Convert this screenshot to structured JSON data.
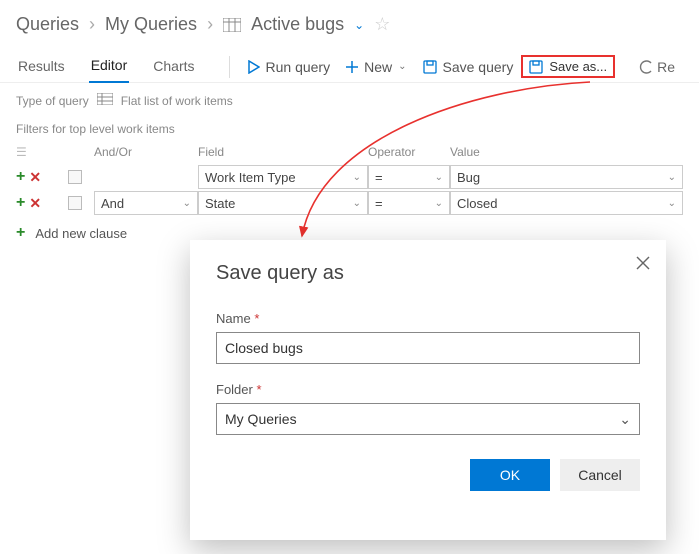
{
  "breadcrumb": {
    "root": "Queries",
    "mid": "My Queries",
    "leaf": "Active bugs"
  },
  "tabs": {
    "results": "Results",
    "editor": "Editor",
    "charts": "Charts"
  },
  "toolbar": {
    "run": "Run query",
    "new": "New",
    "save": "Save query",
    "saveas": "Save as...",
    "revert": "Re"
  },
  "typeRow": {
    "label": "Type of query",
    "value": "Flat list of work items"
  },
  "filtersLabel": "Filters for top level work items",
  "headers": {
    "andor": "And/Or",
    "field": "Field",
    "op": "Operator",
    "value": "Value"
  },
  "rows": [
    {
      "andor": "",
      "field": "Work Item Type",
      "op": "=",
      "value": "Bug"
    },
    {
      "andor": "And",
      "field": "State",
      "op": "=",
      "value": "Closed"
    }
  ],
  "addClause": "Add new clause",
  "dialog": {
    "title": "Save query as",
    "nameLabel": "Name",
    "nameValue": "Closed bugs",
    "folderLabel": "Folder",
    "folderValue": "My Queries",
    "ok": "OK",
    "cancel": "Cancel"
  }
}
